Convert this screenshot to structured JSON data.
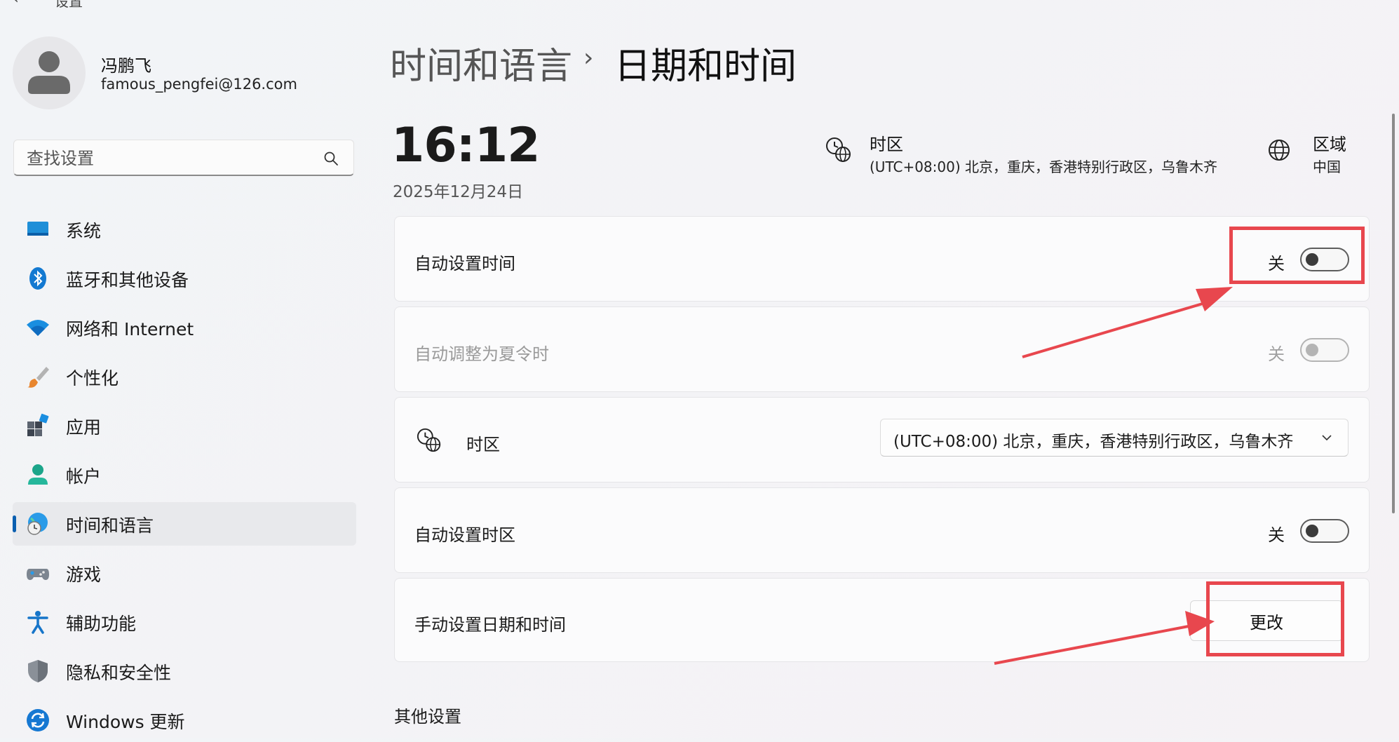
{
  "window": {
    "app_title": "设置",
    "back_icon": "back-arrow-icon"
  },
  "profile": {
    "name": "冯鹏飞",
    "email": "famous_pengfei@126.com"
  },
  "search": {
    "placeholder": "查找设置"
  },
  "sidebar": {
    "items": [
      {
        "label": "系统",
        "icon": "system-monitor-icon"
      },
      {
        "label": "蓝牙和其他设备",
        "icon": "bluetooth-icon"
      },
      {
        "label": "网络和 Internet",
        "icon": "wifi-icon"
      },
      {
        "label": "个性化",
        "icon": "paintbrush-icon"
      },
      {
        "label": "应用",
        "icon": "apps-icon"
      },
      {
        "label": "帐户",
        "icon": "person-icon"
      },
      {
        "label": "时间和语言",
        "icon": "globe-clock-icon",
        "selected": true
      },
      {
        "label": "游戏",
        "icon": "gamepad-icon"
      },
      {
        "label": "辅助功能",
        "icon": "accessibility-icon"
      },
      {
        "label": "隐私和安全性",
        "icon": "shield-icon"
      },
      {
        "label": "Windows 更新",
        "icon": "update-icon"
      }
    ]
  },
  "header": {
    "breadcrumb_parent": "时间和语言",
    "separator": "›",
    "breadcrumb_current": "日期和时间"
  },
  "summary": {
    "time": "16:12",
    "date": "2025年12月24日",
    "timezone_label": "时区",
    "timezone_value": "(UTC+08:00) 北京，重庆，香港特别行政区，乌鲁木齐",
    "region_label": "区域",
    "region_value": "中国"
  },
  "settings": {
    "auto_time": {
      "label": "自动设置时间",
      "state": "关"
    },
    "dst": {
      "label": "自动调整为夏令时",
      "state": "关",
      "disabled": true
    },
    "timezone": {
      "label": "时区",
      "value": "(UTC+08:00) 北京，重庆，香港特别行政区，乌鲁木齐"
    },
    "auto_timezone": {
      "label": "自动设置时区",
      "state": "关"
    },
    "manual": {
      "label": "手动设置日期和时间",
      "button": "更改"
    }
  },
  "section": {
    "other_settings": "其他设置"
  },
  "colors": {
    "accent": "#0a5fb0",
    "annotation": "#e8474e",
    "selected_bg": "#e8e9ec"
  }
}
